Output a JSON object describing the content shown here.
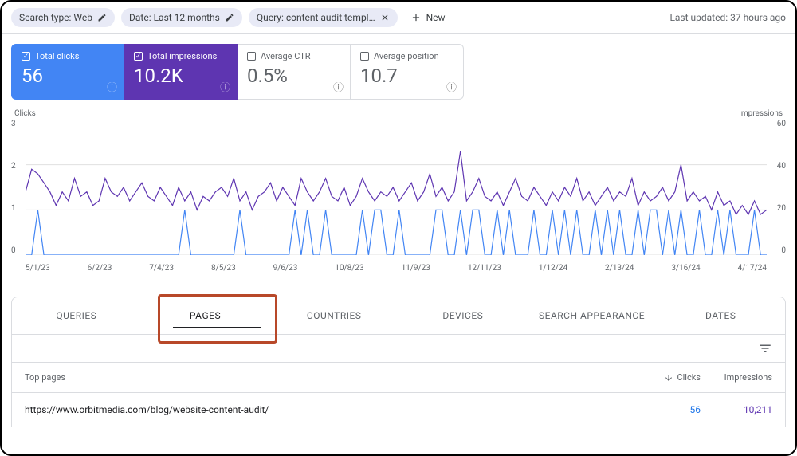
{
  "topbar": {
    "chips": [
      {
        "label": "Search type: Web",
        "icon": "pencil"
      },
      {
        "label": "Date: Last 12 months",
        "icon": "pencil"
      },
      {
        "label": "Query: content audit templ…",
        "icon": "close"
      }
    ],
    "new_label": "New",
    "last_updated": "Last updated: 37 hours ago"
  },
  "cards": {
    "clicks": {
      "label": "Total clicks",
      "value": "56"
    },
    "impressions": {
      "label": "Total impressions",
      "value": "10.2K"
    },
    "ctr": {
      "label": "Average CTR",
      "value": "0.5%"
    },
    "position": {
      "label": "Average position",
      "value": "10.7"
    }
  },
  "chart_data": {
    "type": "line",
    "left_label": "Clicks",
    "right_label": "Impressions",
    "y_left": {
      "ticks": [
        "3",
        "2",
        "1",
        "0"
      ],
      "range": [
        0,
        3
      ]
    },
    "y_right": {
      "ticks": [
        "60",
        "40",
        "20",
        "0"
      ],
      "range": [
        0,
        60
      ]
    },
    "x_ticks": [
      "5/1/23",
      "6/2/23",
      "7/4/23",
      "8/5/23",
      "9/6/23",
      "10/8/23",
      "11/9/23",
      "12/11/23",
      "1/12/24",
      "2/13/24",
      "3/16/24",
      "4/17/24"
    ],
    "series": [
      {
        "name": "Impressions",
        "axis": "right",
        "color": "#5e35b1",
        "values": [
          28,
          38,
          36,
          32,
          28,
          22,
          28,
          24,
          34,
          26,
          28,
          22,
          24,
          34,
          28,
          26,
          30,
          24,
          28,
          32,
          26,
          24,
          30,
          26,
          22,
          30,
          24,
          28,
          20,
          26,
          24,
          28,
          30,
          26,
          34,
          24,
          28,
          20,
          26,
          28,
          32,
          24,
          30,
          26,
          22,
          34,
          28,
          24,
          28,
          34,
          26,
          24,
          30,
          22,
          26,
          34,
          28,
          24,
          28,
          26,
          30,
          24,
          28,
          32,
          24,
          28,
          36,
          26,
          30,
          24,
          28,
          46,
          24,
          28,
          34,
          26,
          24,
          28,
          22,
          28,
          34,
          26,
          24,
          30,
          26,
          22,
          28,
          24,
          30,
          26,
          34,
          24,
          28,
          22,
          26,
          30,
          24,
          28,
          26,
          34,
          22,
          28,
          24,
          26,
          30,
          24,
          28,
          40,
          24,
          28,
          24,
          26,
          20,
          28,
          22,
          24,
          18,
          22,
          18,
          24,
          18,
          20
        ]
      },
      {
        "name": "Clicks",
        "axis": "left",
        "color": "#4285f4",
        "values": [
          0,
          0,
          1,
          0,
          0,
          0,
          0,
          0,
          0,
          0,
          0,
          0,
          0,
          0,
          0,
          0,
          0,
          0,
          0,
          0,
          0,
          0,
          0,
          0,
          0,
          0,
          1,
          0,
          0,
          0,
          0,
          0,
          0,
          0,
          0,
          1,
          0,
          0,
          0,
          0,
          0,
          0,
          0,
          0,
          1,
          0,
          1,
          0,
          0,
          1,
          0,
          0,
          0,
          0,
          0,
          1,
          0,
          1,
          1,
          0,
          0,
          1,
          0,
          0,
          0,
          0,
          0,
          1,
          1,
          0,
          0,
          1,
          0,
          1,
          1,
          0,
          0,
          1,
          0,
          1,
          0,
          0,
          0,
          1,
          0,
          0,
          1,
          0,
          1,
          0,
          1,
          0,
          0,
          1,
          0,
          1,
          0,
          1,
          0,
          0,
          1,
          0,
          1,
          1,
          0,
          1,
          0,
          1,
          0,
          0,
          1,
          0,
          0,
          1,
          0,
          1,
          0,
          0,
          0,
          1,
          0,
          0
        ]
      }
    ]
  },
  "tabs": {
    "items": [
      "QUERIES",
      "PAGES",
      "COUNTRIES",
      "DEVICES",
      "SEARCH APPEARANCE",
      "DATES"
    ],
    "active_index": 1
  },
  "table": {
    "header_pages": "Top pages",
    "header_clicks": "Clicks",
    "header_impressions": "Impressions",
    "rows": [
      {
        "url": "https://www.orbitmedia.com/blog/website-content-audit/",
        "clicks": "56",
        "impressions": "10,211"
      }
    ]
  }
}
